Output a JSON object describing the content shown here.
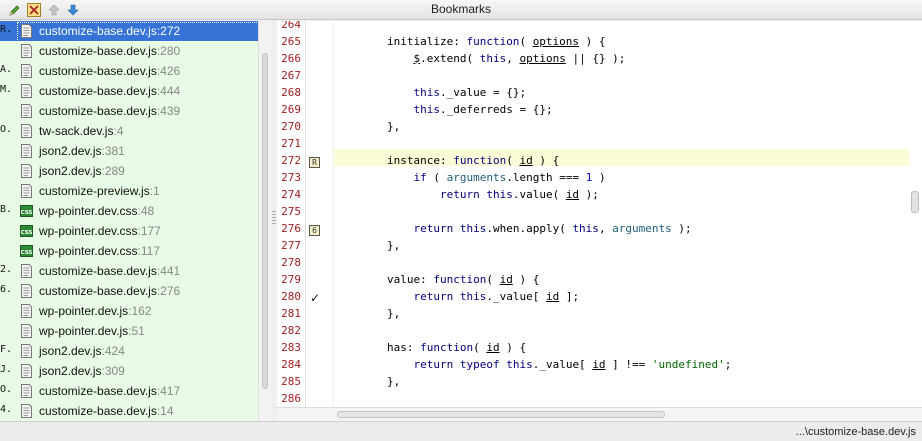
{
  "window": {
    "title": "Bookmarks"
  },
  "toolbar": {
    "icons": [
      "pencil-icon",
      "delete-icon",
      "arrow-up-icon",
      "arrow-down-icon"
    ]
  },
  "bookmarks": [
    {
      "key": "R.",
      "file": "customize-base.dev.js",
      "line": ":272",
      "type": "js",
      "selected": true
    },
    {
      "key": "",
      "file": "customize-base.dev.js",
      "line": ":280",
      "type": "js"
    },
    {
      "key": "A.",
      "file": "customize-base.dev.js",
      "line": ":426",
      "type": "js"
    },
    {
      "key": "M.",
      "file": "customize-base.dev.js",
      "line": ":444",
      "type": "js"
    },
    {
      "key": "",
      "file": "customize-base.dev.js",
      "line": ":439",
      "type": "js"
    },
    {
      "key": "O.",
      "file": "tw-sack.dev.js",
      "line": ":4",
      "type": "js"
    },
    {
      "key": "",
      "file": "json2.dev.js",
      "line": ":381",
      "type": "js"
    },
    {
      "key": "",
      "file": "json2.dev.js",
      "line": ":289",
      "type": "js"
    },
    {
      "key": "",
      "file": "customize-preview.js",
      "line": ":1",
      "type": "js"
    },
    {
      "key": "B.",
      "file": "wp-pointer.dev.css",
      "line": ":48",
      "type": "css"
    },
    {
      "key": "",
      "file": "wp-pointer.dev.css",
      "line": ":177",
      "type": "css"
    },
    {
      "key": "",
      "file": "wp-pointer.dev.css",
      "line": ":117",
      "type": "css"
    },
    {
      "key": "2.",
      "file": "customize-base.dev.js",
      "line": ":441",
      "type": "js"
    },
    {
      "key": "6.",
      "file": "customize-base.dev.js",
      "line": ":276",
      "type": "js"
    },
    {
      "key": "",
      "file": "wp-pointer.dev.js",
      "line": ":162",
      "type": "js"
    },
    {
      "key": "",
      "file": "wp-pointer.dev.js",
      "line": ":51",
      "type": "js"
    },
    {
      "key": "F.",
      "file": "json2.dev.js",
      "line": ":424",
      "type": "js"
    },
    {
      "key": "J.",
      "file": "json2.dev.js",
      "line": ":309",
      "type": "js"
    },
    {
      "key": "O.",
      "file": "customize-base.dev.js",
      "line": ":417",
      "type": "js"
    },
    {
      "key": "4.",
      "file": "customize-base.dev.js",
      "line": ":14",
      "type": "js"
    }
  ],
  "editor": {
    "line_numbers": [
      "264",
      "265",
      "266",
      "267",
      "268",
      "269",
      "270",
      "271",
      "272",
      "273",
      "274",
      "275",
      "276",
      "277",
      "278",
      "279",
      "280",
      "281",
      "282",
      "283",
      "284",
      "285",
      "286"
    ],
    "gutter_marks": {
      "272": "R",
      "276": "6"
    },
    "check_line": "280",
    "check_glyph": "✓",
    "code": {
      "l265": {
        "a": "\t\tinitialize: ",
        "b": "function",
        "c": "( ",
        "d": "options",
        "e": " ) {"
      },
      "l266": {
        "a": "\t\t\t",
        "b": "$",
        "c": ".extend( ",
        "d": "this",
        "e": ", ",
        "f": "options",
        "g": " || {} );"
      },
      "l268": {
        "a": "\t\t\t",
        "b": "this",
        "c": "._value = {};"
      },
      "l269": {
        "a": "\t\t\t",
        "b": "this",
        "c": "._deferreds = {};"
      },
      "l270": "\t\t},",
      "l272": {
        "a": "\t\tinstance: ",
        "b": "function",
        "c": "( ",
        "d": "id",
        "e": " ) {"
      },
      "l273": {
        "a": "\t\t\t",
        "b": "if",
        "c": " ( ",
        "d": "arguments",
        "e": ".length === ",
        "f": "1",
        "g": " )"
      },
      "l274": {
        "a": "\t\t\t\t",
        "b": "return this",
        "c": ".value( ",
        "d": "id",
        "e": " );"
      },
      "l276": {
        "a": "\t\t\t",
        "b": "return this",
        "c": ".when.apply( ",
        "d": "this",
        "e": ", ",
        "f": "arguments",
        "g": " );"
      },
      "l277": "\t\t},",
      "l279": {
        "a": "\t\tvalue: ",
        "b": "function",
        "c": "( ",
        "d": "id",
        "e": " ) {"
      },
      "l280": {
        "a": "\t\t\t",
        "b": "return this",
        "c": "._value[ ",
        "d": "id",
        "e": " ];"
      },
      "l281": "\t\t},",
      "l283": {
        "a": "\t\thas: ",
        "b": "function",
        "c": "( ",
        "d": "id",
        "e": " ) {"
      },
      "l284": {
        "a": "\t\t\t",
        "b": "return typeof this",
        "c": "._value[ ",
        "d": "id",
        "e": " ] !== ",
        "f": "'undefined'",
        "g": ";"
      },
      "l285": "\t\t},"
    }
  },
  "status": {
    "path": "...\\customize-base.dev.js"
  },
  "colors": {
    "selection": "#3574d6",
    "list_bg": "#e8fbe4",
    "line_number": "#a02020",
    "current_line": "#fbfbd7"
  }
}
